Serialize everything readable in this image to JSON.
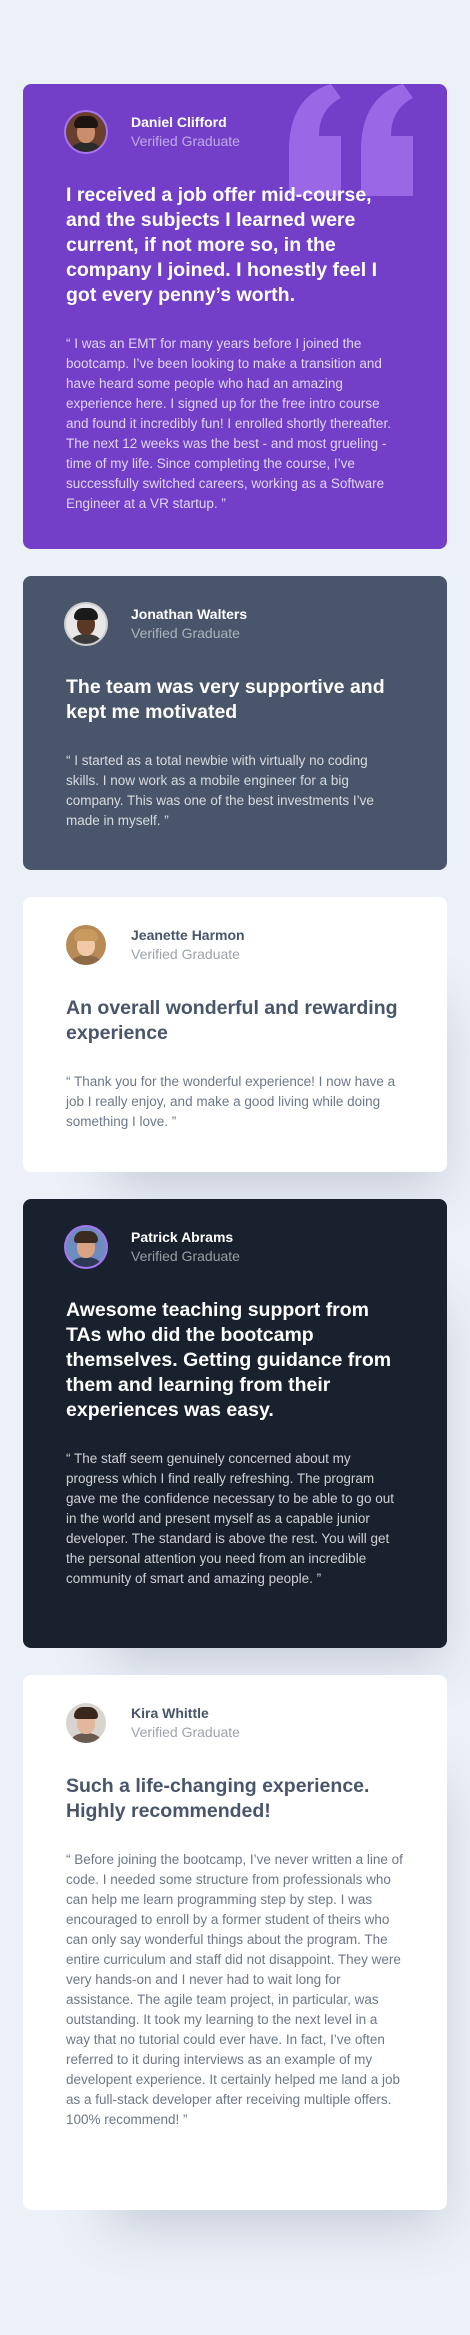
{
  "theme": {
    "background": "#ECF1F8",
    "violet": "#733FC8",
    "grayish_blue": "#48556A",
    "white": "#FFFFFF",
    "very_dark_blue": "#19212E",
    "light_violet_accent": "#A775F1"
  },
  "testimonials": [
    {
      "name": "Daniel Clifford",
      "role": "Verified Graduate",
      "title": "I received a job offer mid-course, and the subjects I learned were current, if not more so, in the company I joined. I honestly feel I got every penny’s worth.",
      "quote": "“ I was an EMT for many years before I joined the bootcamp. I’ve been looking to make a transition and have heard some people who had an amazing experience here. I signed up for the free intro course and found it incredibly fun! I enrolled shortly thereafter. The next 12 weeks was the best - and most grueling - time of my life. Since completing the course, I’ve successfully switched careers, working as a Software Engineer at a VR startup. ”",
      "avatar_icon": "avatar-daniel"
    },
    {
      "name": "Jonathan Walters",
      "role": "Verified Graduate",
      "title": "The team was very supportive and kept me motivated",
      "quote": "“ I started as a total newbie with virtually no coding skills. I now work as a mobile engineer for a big company. This was one of the best investments I’ve made in myself. ”",
      "avatar_icon": "avatar-jonathan"
    },
    {
      "name": "Jeanette Harmon",
      "role": "Verified Graduate",
      "title": "An overall wonderful and rewarding experience",
      "quote": "“ Thank you for the wonderful experience! I now have a job I really enjoy, and make a good living while doing something I love. ”",
      "avatar_icon": "avatar-jeanette"
    },
    {
      "name": "Patrick Abrams",
      "role": "Verified Graduate",
      "title": "Awesome teaching support from TAs who did the bootcamp themselves. Getting guidance from them and learning from their experiences was easy.",
      "quote": "“ The staff seem genuinely concerned about my progress which I find really refreshing. The program gave me the confidence necessary to be able to go out in the world and present myself as a capable junior developer. The standard is above the rest. You will get the personal attention you need from an incredible community of smart and amazing people. ”",
      "avatar_icon": "avatar-patrick"
    },
    {
      "name": "Kira Whittle",
      "role": "Verified Graduate",
      "title": "Such a life-changing experience. Highly recommended!",
      "quote": "“ Before joining the bootcamp, I’ve never written a line of code. I needed some structure from professionals who can help me learn programming step by step. I was encouraged to enroll by a former student of theirs who can only say wonderful things about the program. The entire curriculum and staff did not disappoint. They were very hands-on and I never had to wait long for assistance. The agile team project, in particular, was outstanding. It took my learning to the next level in a way that no tutorial could ever have. In fact, I’ve often referred to it during interviews as an example of my developent experience. It certainly helped me land a job as a full-stack developer after receiving multiple offers. 100% recommend! ”",
      "avatar_icon": "avatar-kira"
    }
  ]
}
